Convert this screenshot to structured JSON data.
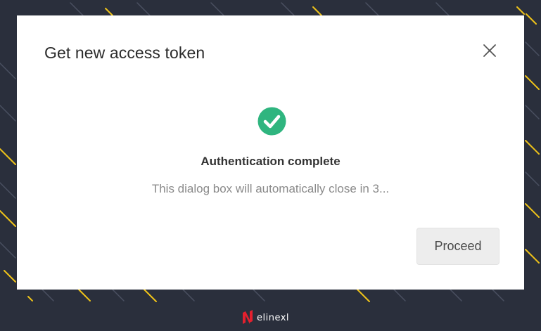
{
  "colors": {
    "background": "#2a2f3c",
    "stripe_yellow": "#f0c419",
    "stripe_grey": "#4a5061",
    "dialog": "#ffffff",
    "success": "#2fb57f",
    "brand_red": "#e4202e"
  },
  "dialog": {
    "title": "Get new access token",
    "close_icon": "close-icon",
    "status_icon": "check-circle-icon",
    "status_title": "Authentication complete",
    "status_message": "This dialog box will automatically close in 3...",
    "proceed_label": "Proceed"
  },
  "brand": {
    "name": "elinexl",
    "icon": "elinext-logo-icon"
  }
}
